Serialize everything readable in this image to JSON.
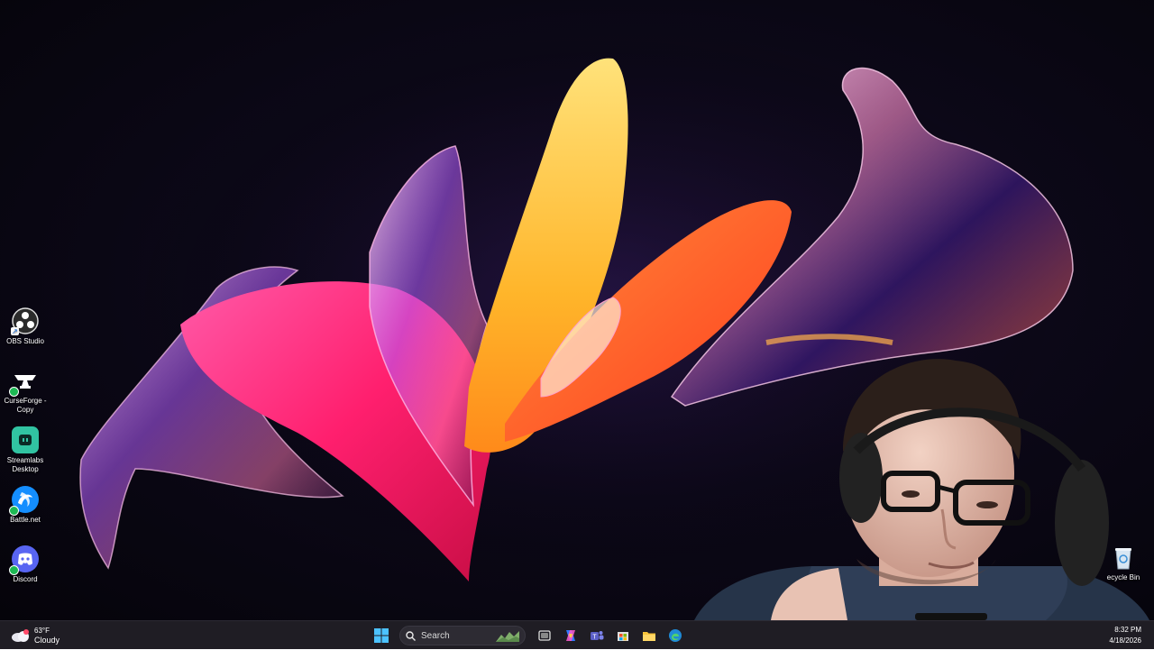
{
  "desktop_icons": [
    {
      "label": "OBS Studio",
      "icon": "obs-icon"
    },
    {
      "label": "CurseForge - Copy",
      "icon": "curseforge-icon"
    },
    {
      "label": "Streamlabs Desktop",
      "icon": "streamlabs-icon"
    },
    {
      "label": "Battle.net",
      "icon": "battlenet-icon"
    },
    {
      "label": "Discord",
      "icon": "discord-icon"
    }
  ],
  "recycle_bin": {
    "label": "ecycle Bin",
    "icon": "recycle-bin-icon"
  },
  "weather": {
    "temperature": "63°F",
    "condition": "Cloudy",
    "icon": "cloud-icon"
  },
  "taskbar": {
    "search_placeholder": "Search",
    "pinned": [
      "windows-start-icon",
      "search-icon",
      "task-view-icon",
      "copilot-icon",
      "teams-icon",
      "microsoft-store-icon",
      "file-explorer-icon",
      "edge-icon"
    ]
  },
  "clock": {
    "time": "8:32 PM",
    "date": "4/18/2026"
  },
  "colors": {
    "taskbar_bg": "#1f1d24",
    "pink": "#ff2a7a",
    "orange": "#ff7a1a",
    "yellow": "#ffc93a",
    "purple": "#7a3cff"
  }
}
